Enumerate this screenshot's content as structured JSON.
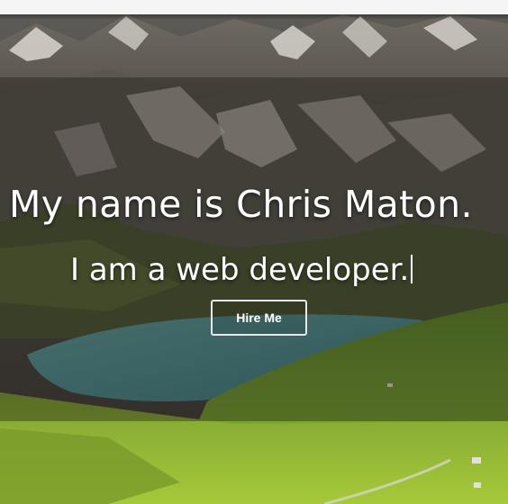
{
  "hero": {
    "heading": "My name is Chris Maton.",
    "subheading": "I am a web developer.",
    "cta_label": "Hire Me"
  },
  "colors": {
    "text": "#ffffff",
    "topbar": "#f5f5f5",
    "overlay": "rgba(30,24,18,0.38)",
    "button_border": "#e8e8e8"
  }
}
